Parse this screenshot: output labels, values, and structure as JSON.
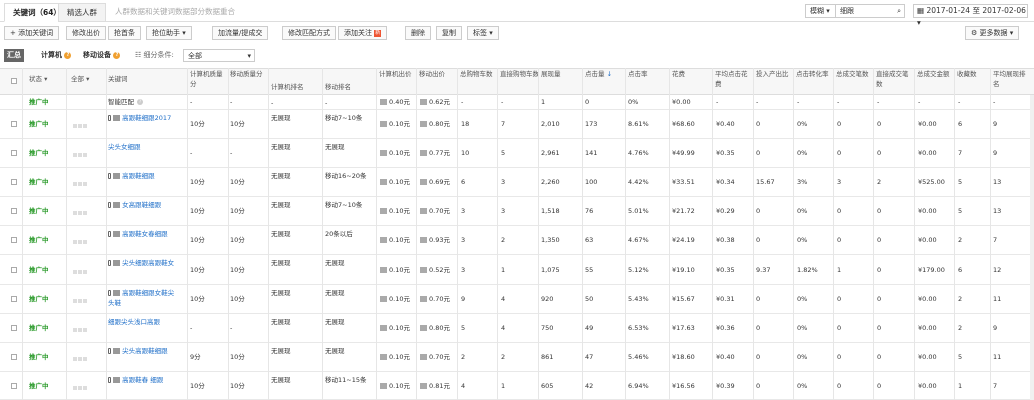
{
  "tabs": [
    "关键词（64）",
    "精选人群",
    "人群数据和关键词数据部分数据重合"
  ],
  "search": {
    "scope": "模糊",
    "value": "细跟",
    "date_range": "2017-01-24 至 2017-02-06"
  },
  "toolbar": {
    "add_keyword": "+ 添加关键词",
    "modify_bid": "修改出价",
    "grab_position": "抢首条",
    "bid_helper": "抢位助手",
    "add_traffic": "加流量/提成交",
    "match_mode": "修改匹配方式",
    "add_follow": "添加关注",
    "new_badge": "新",
    "delete": "删除",
    "copy": "复制",
    "tag": "标签",
    "more_data": "更多数据"
  },
  "filters": {
    "summary": "汇总",
    "pc": "计算机",
    "mobile": "移动设备",
    "condition_label": "细分条件:",
    "condition_value": "全部"
  },
  "headers": [
    "状态",
    "全部",
    "关键词",
    "计算机质量分",
    "移动质量分",
    "计算机排名",
    "移动排名",
    "计算机出价",
    "移动出价",
    "总购物车数",
    "直接购物车数",
    "展现量",
    "点击量",
    "点击率",
    "花费",
    "平均点击花费",
    "投入产出比",
    "点击转化率",
    "总成交笔数",
    "直接成交笔数",
    "总成交金额",
    "收藏数",
    "平均展现排名"
  ],
  "rows": [
    {
      "status": "推广中",
      "kw": "智能匹配",
      "cq": "-",
      "mq": "-",
      "cr": "-",
      "mr": "-",
      "cb": "0.40元",
      "mb": "0.62元",
      "tc": "-",
      "dc": "-",
      "imp": "1",
      "clk": "0",
      "ctr": "0%",
      "cost": "¥0.00",
      "cpc": "-",
      "roi": "-",
      "cvr": "-",
      "to": "-",
      "do": "-",
      "amt": "-",
      "fav": "-",
      "rank": "-"
    },
    {
      "status": "推广中",
      "kw": "高跟鞋细跟2017",
      "cq": "10分",
      "mq": "10分",
      "cr": "无展现",
      "mr": "移动7~10条",
      "cb": "0.10元",
      "mb": "0.80元",
      "tc": "18",
      "dc": "7",
      "imp": "2,010",
      "clk": "173",
      "ctr": "8.61%",
      "cost": "¥68.60",
      "cpc": "¥0.40",
      "roi": "0",
      "cvr": "0%",
      "to": "0",
      "do": "0",
      "amt": "¥0.00",
      "fav": "6",
      "rank": "9"
    },
    {
      "status": "推广中",
      "kw": "尖头女细跟",
      "cq": "-",
      "mq": "-",
      "cr": "无展现",
      "mr": "无展现",
      "cb": "0.10元",
      "mb": "0.77元",
      "tc": "10",
      "dc": "5",
      "imp": "2,961",
      "clk": "141",
      "ctr": "4.76%",
      "cost": "¥49.99",
      "cpc": "¥0.35",
      "roi": "0",
      "cvr": "0%",
      "to": "0",
      "do": "0",
      "amt": "¥0.00",
      "fav": "7",
      "rank": "9"
    },
    {
      "status": "推广中",
      "kw": "高跟鞋细跟",
      "cq": "10分",
      "mq": "10分",
      "cr": "无展现",
      "mr": "移动16~20条",
      "cb": "0.10元",
      "mb": "0.69元",
      "tc": "6",
      "dc": "3",
      "imp": "2,260",
      "clk": "100",
      "ctr": "4.42%",
      "cost": "¥33.51",
      "cpc": "¥0.34",
      "roi": "15.67",
      "cvr": "3%",
      "to": "3",
      "do": "2",
      "amt": "¥525.00",
      "fav": "5",
      "rank": "13"
    },
    {
      "status": "推广中",
      "kw": "女高跟鞋细跟",
      "cq": "10分",
      "mq": "10分",
      "cr": "无展现",
      "mr": "移动7~10条",
      "cb": "0.10元",
      "mb": "0.70元",
      "tc": "3",
      "dc": "3",
      "imp": "1,518",
      "clk": "76",
      "ctr": "5.01%",
      "cost": "¥21.72",
      "cpc": "¥0.29",
      "roi": "0",
      "cvr": "0%",
      "to": "0",
      "do": "0",
      "amt": "¥0.00",
      "fav": "5",
      "rank": "13"
    },
    {
      "status": "推广中",
      "kw": "高跟鞋女春细跟",
      "cq": "10分",
      "mq": "10分",
      "cr": "无展现",
      "mr": "20条以后",
      "cb": "0.10元",
      "mb": "0.93元",
      "tc": "3",
      "dc": "2",
      "imp": "1,350",
      "clk": "63",
      "ctr": "4.67%",
      "cost": "¥24.19",
      "cpc": "¥0.38",
      "roi": "0",
      "cvr": "0%",
      "to": "0",
      "do": "0",
      "amt": "¥0.00",
      "fav": "2",
      "rank": "7"
    },
    {
      "status": "推广中",
      "kw": "尖头细跟高跟鞋女",
      "cq": "10分",
      "mq": "10分",
      "cr": "无展现",
      "mr": "无展现",
      "cb": "0.10元",
      "mb": "0.52元",
      "tc": "3",
      "dc": "1",
      "imp": "1,075",
      "clk": "55",
      "ctr": "5.12%",
      "cost": "¥19.10",
      "cpc": "¥0.35",
      "roi": "9.37",
      "cvr": "1.82%",
      "to": "1",
      "do": "0",
      "amt": "¥179.00",
      "fav": "6",
      "rank": "12"
    },
    {
      "status": "推广中",
      "kw": "高跟鞋细跟女鞋尖头鞋",
      "cq": "10分",
      "mq": "10分",
      "cr": "无展现",
      "mr": "无展现",
      "cb": "0.10元",
      "mb": "0.70元",
      "tc": "9",
      "dc": "4",
      "imp": "920",
      "clk": "50",
      "ctr": "5.43%",
      "cost": "¥15.67",
      "cpc": "¥0.31",
      "roi": "0",
      "cvr": "0%",
      "to": "0",
      "do": "0",
      "amt": "¥0.00",
      "fav": "2",
      "rank": "11"
    },
    {
      "status": "推广中",
      "kw": "细跟尖头浅口高跟",
      "cq": "-",
      "mq": "-",
      "cr": "无展现",
      "mr": "无展现",
      "cb": "0.10元",
      "mb": "0.80元",
      "tc": "5",
      "dc": "4",
      "imp": "750",
      "clk": "49",
      "ctr": "6.53%",
      "cost": "¥17.63",
      "cpc": "¥0.36",
      "roi": "0",
      "cvr": "0%",
      "to": "0",
      "do": "0",
      "amt": "¥0.00",
      "fav": "2",
      "rank": "9"
    },
    {
      "status": "推广中",
      "kw": "尖头高跟鞋细跟",
      "cq": "9分",
      "mq": "10分",
      "cr": "无展现",
      "mr": "无展现",
      "cb": "0.10元",
      "mb": "0.70元",
      "tc": "2",
      "dc": "2",
      "imp": "861",
      "clk": "47",
      "ctr": "5.46%",
      "cost": "¥18.60",
      "cpc": "¥0.40",
      "roi": "0",
      "cvr": "0%",
      "to": "0",
      "do": "0",
      "amt": "¥0.00",
      "fav": "5",
      "rank": "11"
    },
    {
      "status": "推广中",
      "kw": "高跟鞋春 细跟",
      "cq": "10分",
      "mq": "10分",
      "cr": "无展现",
      "mr": "移动11~15条",
      "cb": "0.10元",
      "mb": "0.81元",
      "tc": "4",
      "dc": "1",
      "imp": "605",
      "clk": "42",
      "ctr": "6.94%",
      "cost": "¥16.56",
      "cpc": "¥0.39",
      "roi": "0",
      "cvr": "0%",
      "to": "0",
      "do": "0",
      "amt": "¥0.00",
      "fav": "1",
      "rank": "7"
    }
  ]
}
